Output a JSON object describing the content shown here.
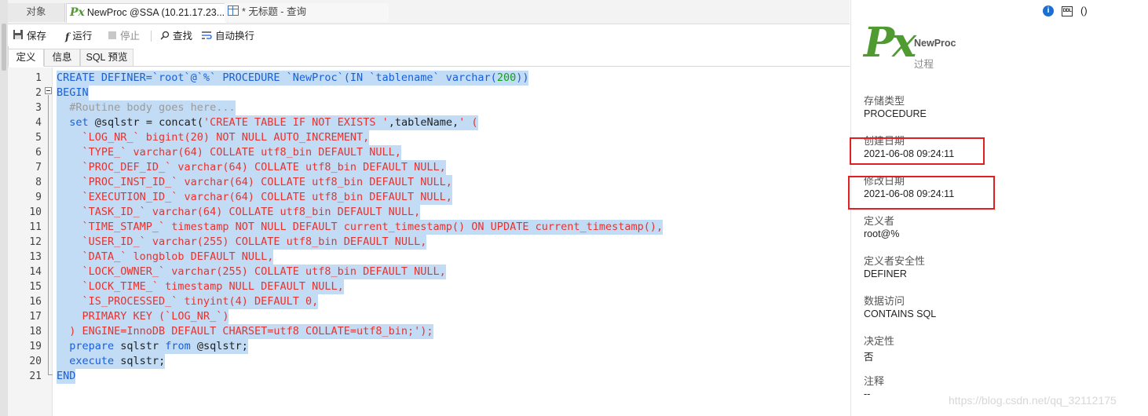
{
  "tabs": {
    "objects": "对象",
    "proc": "NewProc @SSA (10.21.17.23...",
    "query": "* 无标题 - 查询"
  },
  "toolbar": {
    "save": "保存",
    "run": "运行",
    "stop": "停止",
    "find": "查找",
    "wrap": "自动换行"
  },
  "subtabs": {
    "definition": "定义",
    "info": "信息",
    "sql_preview": "SQL 预览"
  },
  "code": {
    "line_numbers": [
      "1",
      "2",
      "3",
      "4",
      "5",
      "6",
      "7",
      "8",
      "9",
      "10",
      "11",
      "12",
      "13",
      "14",
      "15",
      "16",
      "17",
      "18",
      "19",
      "20",
      "21"
    ],
    "l1": [
      "CREATE DEFINER=`root`@`%` PROCEDURE `NewProc`(IN `tablename` varchar(",
      "200",
      "))"
    ],
    "l2": "BEGIN",
    "l3": "  #Routine body goes here...",
    "l4": [
      "  set ",
      "@sqlstr",
      " = ",
      "concat",
      "(",
      "'CREATE TABLE IF NOT EXISTS '",
      ",",
      "tableName",
      ",",
      "' ("
    ],
    "l5": "    `LOG_NR_` bigint(20) NOT NULL AUTO_INCREMENT,",
    "l6": "    `TYPE_` varchar(64) COLLATE utf8_bin DEFAULT NULL,",
    "l7": "    `PROC_DEF_ID_` varchar(64) COLLATE utf8_bin DEFAULT NULL,",
    "l8": "    `PROC_INST_ID_` varchar(64) COLLATE utf8_bin DEFAULT NULL,",
    "l9": "    `EXECUTION_ID_` varchar(64) COLLATE utf8_bin DEFAULT NULL,",
    "l10": "    `TASK_ID_` varchar(64) COLLATE utf8_bin DEFAULT NULL,",
    "l11": "    `TIME_STAMP_` timestamp NOT NULL DEFAULT current_timestamp() ON UPDATE current_timestamp(),",
    "l12": "    `USER_ID_` varchar(255) COLLATE utf8_bin DEFAULT NULL,",
    "l13": "    `DATA_` longblob DEFAULT NULL,",
    "l14": "    `LOCK_OWNER_` varchar(255) COLLATE utf8_bin DEFAULT NULL,",
    "l15": "    `LOCK_TIME_` timestamp NULL DEFAULT NULL,",
    "l16": "    `IS_PROCESSED_` tinyint(4) DEFAULT 0,",
    "l17": "    PRIMARY KEY (`LOG_NR_`)",
    "l18": "  ) ENGINE=InnoDB DEFAULT CHARSET=utf8 COLLATE=utf8_bin;');",
    "l19": [
      "  ",
      "prepare",
      " sqlstr ",
      "from",
      " @sqlstr;"
    ],
    "l20": [
      "  ",
      "execute",
      " sqlstr;"
    ],
    "l21": "END"
  },
  "panel": {
    "icon_glyph": "Px",
    "name": "NewProc",
    "type": "过程",
    "info_icon": "i",
    "ddl_icon": "DDL",
    "paren_icon": "()",
    "props": [
      {
        "label": "存储类型",
        "value": "PROCEDURE"
      },
      {
        "label": "创建日期",
        "value": "2021-06-08 09:24:11"
      },
      {
        "label": "修改日期",
        "value": "2021-06-08 09:24:11"
      },
      {
        "label": "定义者",
        "value": "root@%"
      },
      {
        "label": "定义者安全性",
        "value": "DEFINER"
      },
      {
        "label": "数据访问",
        "value": "CONTAINS SQL"
      },
      {
        "label": "决定性",
        "value": "否"
      },
      {
        "label": "注释",
        "value": "--"
      }
    ]
  },
  "watermark": "https://blog.csdn.net/qq_32112175",
  "colors": {
    "selection": "#c2dcf5",
    "keyword": "#1a5fd6",
    "string": "#e8322e",
    "number": "#13a018",
    "comment": "#9a9a9a",
    "proc_icon": "#4f9a31",
    "highlight_box": "#e02020"
  }
}
